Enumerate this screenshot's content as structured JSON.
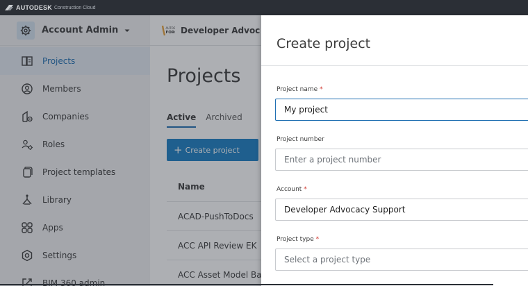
{
  "brand": {
    "main": "AUTODESK",
    "sub": "Construction Cloud"
  },
  "account": {
    "label": "Account Admin"
  },
  "nav": {
    "items": [
      {
        "label": "Projects",
        "icon": "projects-icon",
        "active": true
      },
      {
        "label": "Members",
        "icon": "members-icon",
        "active": false
      },
      {
        "label": "Companies",
        "icon": "companies-icon",
        "active": false
      },
      {
        "label": "Roles",
        "icon": "roles-icon",
        "active": false
      },
      {
        "label": "Project templates",
        "icon": "templates-icon",
        "active": false
      },
      {
        "label": "Library",
        "icon": "library-icon",
        "active": false
      },
      {
        "label": "Apps",
        "icon": "apps-icon",
        "active": false
      },
      {
        "label": "Settings",
        "icon": "settings-icon",
        "active": false
      },
      {
        "label": "BIM 360 admin",
        "icon": "external-link-icon",
        "active": false
      }
    ]
  },
  "header": {
    "project_label": "Developer Advoc"
  },
  "main": {
    "title": "Projects",
    "tabs": [
      {
        "label": "Active",
        "active": true
      },
      {
        "label": "Archived",
        "active": false
      }
    ],
    "create_button": "Create project",
    "table": {
      "column": "Name",
      "rows": [
        "ACAD-PushToDocs",
        "ACC API Review EK",
        "ACC Asset Model Bas"
      ]
    }
  },
  "dialog": {
    "title": "Create project",
    "fields": {
      "project_name": {
        "label": "Project name",
        "required": "*",
        "value": "My project"
      },
      "project_number": {
        "label": "Project number",
        "placeholder": "Enter a project number"
      },
      "account": {
        "label": "Account",
        "required": "*",
        "value": "Developer Advocacy Support"
      },
      "project_type": {
        "label": "Project type",
        "required": "*",
        "placeholder": "Select a project type"
      }
    }
  },
  "colors": {
    "topbar": "#2b2f36",
    "accent": "#1f6fb2",
    "button": "#1a7fc4",
    "required": "#d0352d"
  }
}
